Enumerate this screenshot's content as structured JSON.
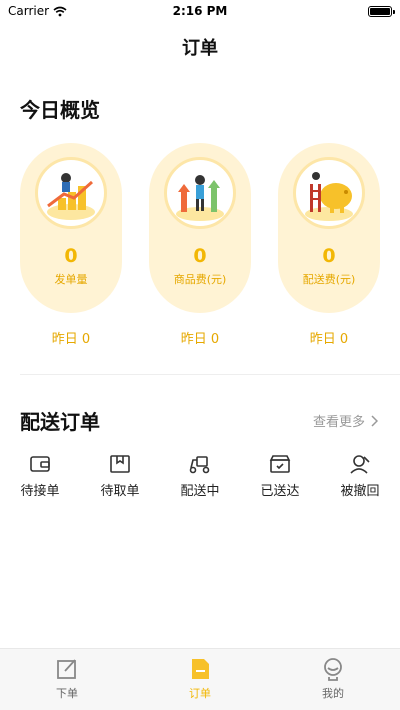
{
  "status_bar": {
    "carrier": "Carrier",
    "time": "2:16 PM"
  },
  "nav": {
    "title": "订单"
  },
  "overview": {
    "title": "今日概览",
    "cards": [
      {
        "value": "0",
        "label": "发单量",
        "yesterday": "昨日 0"
      },
      {
        "value": "0",
        "label": "商品费(元)",
        "yesterday": "昨日 0"
      },
      {
        "value": "0",
        "label": "配送费(元)",
        "yesterday": "昨日 0"
      }
    ]
  },
  "delivery": {
    "title": "配送订单",
    "more": "查看更多",
    "statuses": [
      {
        "label": "待接单",
        "icon": "wallet-icon"
      },
      {
        "label": "待取单",
        "icon": "package-icon"
      },
      {
        "label": "配送中",
        "icon": "scooter-icon"
      },
      {
        "label": "已送达",
        "icon": "delivered-box-icon"
      },
      {
        "label": "被撤回",
        "icon": "user-revoke-icon"
      }
    ]
  },
  "tabbar": {
    "tabs": [
      {
        "label": "下单",
        "icon": "edit-icon"
      },
      {
        "label": "订单",
        "icon": "order-doc-icon",
        "active": true
      },
      {
        "label": "我的",
        "icon": "profile-icon"
      }
    ]
  },
  "colors": {
    "accent": "#f2b705",
    "card_bg": "#fff3d4"
  }
}
